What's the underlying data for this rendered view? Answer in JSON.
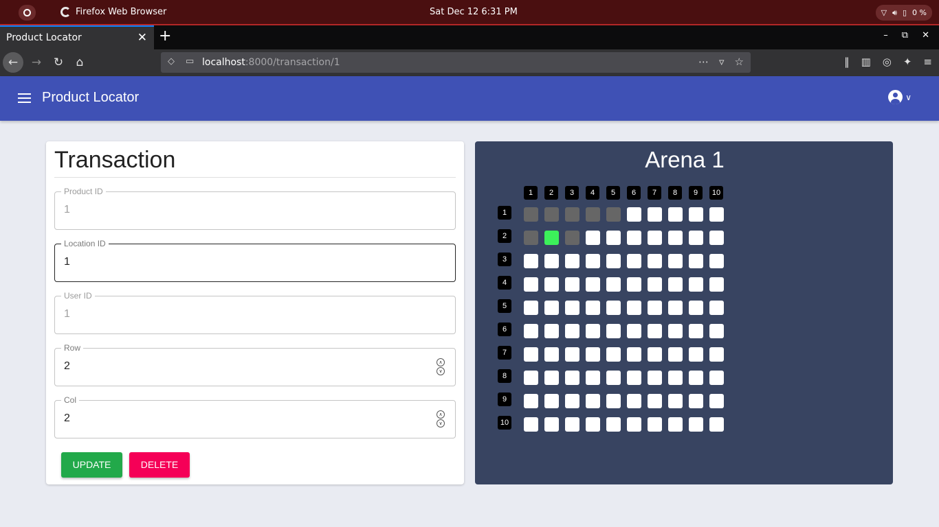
{
  "os": {
    "app_name": "Firefox Web Browser",
    "clock": "Sat Dec 12   6:31 PM",
    "battery": "0 %"
  },
  "browser": {
    "tab_title": "Product Locator",
    "url_host": "localhost",
    "url_rest": ":8000/transaction/1"
  },
  "header": {
    "title": "Product Locator"
  },
  "form": {
    "title": "Transaction",
    "fields": {
      "product_id": {
        "label": "Product ID",
        "value": "1"
      },
      "location_id": {
        "label": "Location ID",
        "value": "1"
      },
      "user_id": {
        "label": "User ID",
        "value": "1"
      },
      "row": {
        "label": "Row",
        "value": "2"
      },
      "col": {
        "label": "Col",
        "value": "2"
      }
    },
    "update_label": "UPDATE",
    "delete_label": "DELETE"
  },
  "arena": {
    "title": "Arena 1",
    "columns": [
      "1",
      "2",
      "3",
      "4",
      "5",
      "6",
      "7",
      "8",
      "9",
      "10"
    ],
    "rows": [
      "1",
      "2",
      "3",
      "4",
      "5",
      "6",
      "7",
      "8",
      "9",
      "10"
    ],
    "grid": [
      [
        "taken",
        "taken",
        "taken",
        "taken",
        "taken",
        "empty",
        "empty",
        "empty",
        "empty",
        "empty"
      ],
      [
        "taken",
        "selected",
        "taken",
        "empty",
        "empty",
        "empty",
        "empty",
        "empty",
        "empty",
        "empty"
      ],
      [
        "empty",
        "empty",
        "empty",
        "empty",
        "empty",
        "empty",
        "empty",
        "empty",
        "empty",
        "empty"
      ],
      [
        "empty",
        "empty",
        "empty",
        "empty",
        "empty",
        "empty",
        "empty",
        "empty",
        "empty",
        "empty"
      ],
      [
        "empty",
        "empty",
        "empty",
        "empty",
        "empty",
        "empty",
        "empty",
        "empty",
        "empty",
        "empty"
      ],
      [
        "empty",
        "empty",
        "empty",
        "empty",
        "empty",
        "empty",
        "empty",
        "empty",
        "empty",
        "empty"
      ],
      [
        "empty",
        "empty",
        "empty",
        "empty",
        "empty",
        "empty",
        "empty",
        "empty",
        "empty",
        "empty"
      ],
      [
        "empty",
        "empty",
        "empty",
        "empty",
        "empty",
        "empty",
        "empty",
        "empty",
        "empty",
        "empty"
      ],
      [
        "empty",
        "empty",
        "empty",
        "empty",
        "empty",
        "empty",
        "empty",
        "empty",
        "empty",
        "empty"
      ],
      [
        "empty",
        "empty",
        "empty",
        "empty",
        "empty",
        "empty",
        "empty",
        "empty",
        "empty",
        "empty"
      ]
    ],
    "colors": {
      "empty": "#ffffff",
      "taken": "#666666",
      "selected": "#3cf05a"
    }
  }
}
